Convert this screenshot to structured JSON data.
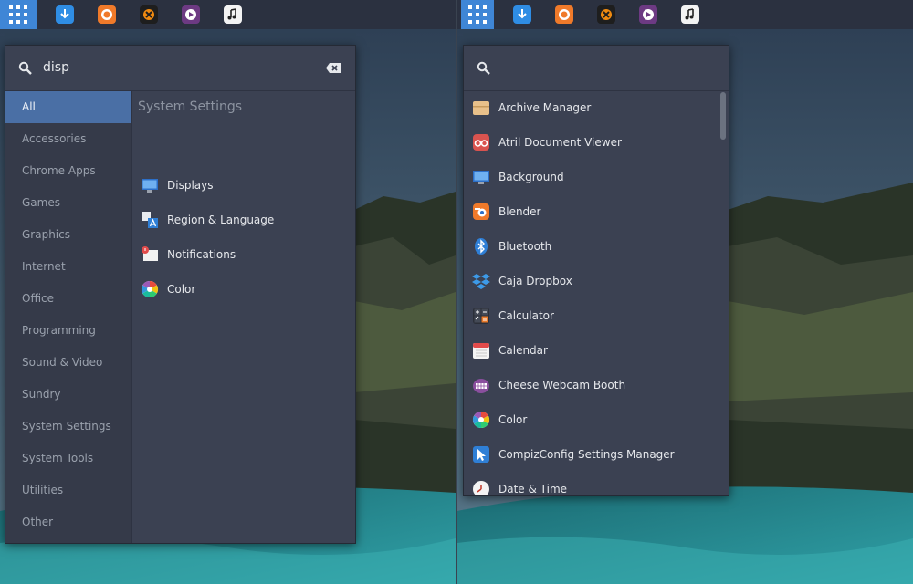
{
  "left_menu": {
    "search": {
      "value": "disp"
    },
    "categories": [
      {
        "label": "All"
      },
      {
        "label": "Accessories"
      },
      {
        "label": "Chrome Apps"
      },
      {
        "label": "Games"
      },
      {
        "label": "Graphics"
      },
      {
        "label": "Internet"
      },
      {
        "label": "Office"
      },
      {
        "label": "Programming"
      },
      {
        "label": "Sound & Video"
      },
      {
        "label": "Sundry"
      },
      {
        "label": "System Settings"
      },
      {
        "label": "System Tools"
      },
      {
        "label": "Utilities"
      },
      {
        "label": "Other"
      }
    ],
    "results_title": "System Settings",
    "results": [
      {
        "label": "Displays",
        "icon": "display-icon"
      },
      {
        "label": "Region & Language",
        "icon": "language-icon"
      },
      {
        "label": "Notifications",
        "icon": "notifications-icon"
      },
      {
        "label": "Color",
        "icon": "color-icon"
      }
    ]
  },
  "right_menu": {
    "search": {
      "value": ""
    },
    "apps": [
      {
        "label": "Archive Manager",
        "icon": "archive-icon"
      },
      {
        "label": "Atril Document Viewer",
        "icon": "atril-icon"
      },
      {
        "label": "Background",
        "icon": "background-icon"
      },
      {
        "label": "Blender",
        "icon": "blender-icon"
      },
      {
        "label": "Bluetooth",
        "icon": "bluetooth-icon"
      },
      {
        "label": "Caja Dropbox",
        "icon": "dropbox-icon"
      },
      {
        "label": "Calculator",
        "icon": "calculator-icon"
      },
      {
        "label": "Calendar",
        "icon": "calendar-icon"
      },
      {
        "label": "Cheese Webcam Booth",
        "icon": "cheese-icon"
      },
      {
        "label": "Color",
        "icon": "color-icon"
      },
      {
        "label": "CompizConfig Settings Manager",
        "icon": "compiz-icon"
      },
      {
        "label": "Date & Time",
        "icon": "clock-icon"
      }
    ]
  },
  "panel_icons": [
    "apps-grid-icon",
    "download-icon",
    "firefox-icon",
    "tool-icon",
    "media-player-icon",
    "music-icon"
  ],
  "colors": {
    "accent": "#3f86d6",
    "selected_category": "#4a6fa5",
    "menu_bg": "#3b4152",
    "panel_bg": "#2b3140"
  }
}
